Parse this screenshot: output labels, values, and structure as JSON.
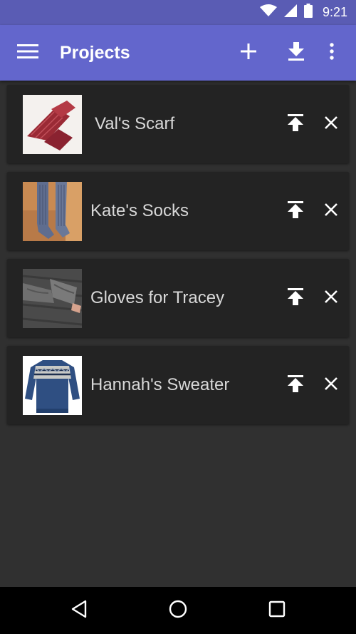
{
  "status_bar": {
    "time": "9:21"
  },
  "app_bar": {
    "title": "Projects",
    "icons": [
      "menu-icon",
      "add-icon",
      "download-icon",
      "more-vert-icon"
    ]
  },
  "projects": [
    {
      "title": "Val's Scarf",
      "thumbnail": "red knitted scarf"
    },
    {
      "title": "Kate's Socks",
      "thumbnail": "blue knitted socks"
    },
    {
      "title": "Gloves for Tracey",
      "thumbnail": "grey cabled gloves"
    },
    {
      "title": "Hannah's Sweater",
      "thumbnail": "blue fair isle sweater"
    }
  ],
  "item_actions": [
    "move-to-top-icon",
    "close-icon"
  ],
  "nav_bar": {
    "icons": [
      "back-icon",
      "home-icon",
      "recents-icon"
    ]
  },
  "colors": {
    "status_bar": "#5a5cb4",
    "app_bar": "#6366cc",
    "background": "#303030",
    "card": "#232323",
    "text": "#d8d8d8"
  }
}
